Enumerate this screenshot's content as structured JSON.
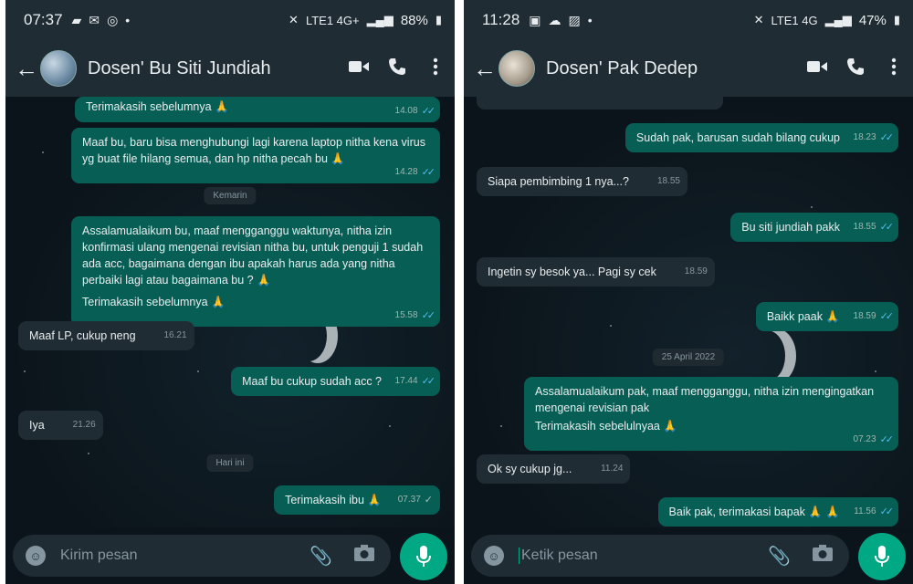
{
  "left": {
    "status": {
      "time": "07:37",
      "network": "LTE1 4G+",
      "battery": "88%"
    },
    "header": {
      "title": "Dosen' Bu Siti Jundiah"
    },
    "messages": [
      {
        "text": "Terimakasih sebelumnya 🙏",
        "time": "14.08"
      },
      {
        "text": "Maaf bu, baru bisa menghubungi lagi karena laptop nitha kena virus yg buat file hilang semua, dan hp nitha pecah bu 🙏",
        "time": "14.28"
      },
      {
        "date": "Kemarin"
      },
      {
        "text": "Assalamualaikum bu, maaf mengganggu waktunya, nitha izin konfirmasi ulang mengenai revisian nitha bu, untuk penguji 1 sudah ada acc, bagaimana dengan ibu apakah harus ada yang nitha perbaiki lagi atau bagaimana bu ? 🙏",
        "text2": "Terimakasih sebelumnya 🙏",
        "time": "15.58"
      },
      {
        "text": "Maaf LP, cukup neng",
        "time": "16.21"
      },
      {
        "text": "Maaf bu cukup sudah acc ?",
        "time": "17.44"
      },
      {
        "text": "Iya",
        "time": "21.26"
      },
      {
        "date": "Hari ini"
      },
      {
        "text": "Terimakasih ibu 🙏",
        "time": "07.37"
      }
    ],
    "composer": {
      "placeholder": "Kirim pesan"
    }
  },
  "right": {
    "status": {
      "time": "11:28",
      "network": "LTE1 4G",
      "battery": "47%"
    },
    "header": {
      "title": "Dosen' Pak Dedep"
    },
    "messages": [
      {
        "text": "Sudah pak, barusan sudah bilang cukup",
        "time": "18.23"
      },
      {
        "text": "Siapa pembimbing 1 nya...?",
        "time": "18.55"
      },
      {
        "text": "Bu siti jundiah pakk",
        "time": "18.55"
      },
      {
        "text": "Ingetin sy besok ya... Pagi sy cek",
        "time": "18.59"
      },
      {
        "text": "Baikk paak 🙏",
        "time": "18.59"
      },
      {
        "date": "25 April 2022"
      },
      {
        "text": "Assalamualaikum pak, maaf mengganggu, nitha izin mengingatkan mengenai revisian pak",
        "text2": "Terimakasih sebelulnyaa 🙏",
        "time": "07.23"
      },
      {
        "text": "Ok sy cukup jg...",
        "time": "11.24"
      },
      {
        "text": "Baik pak, terimakasi bapak 🙏 🙏",
        "time": "11.56"
      }
    ],
    "composer": {
      "placeholder": "Ketik pesan"
    }
  }
}
